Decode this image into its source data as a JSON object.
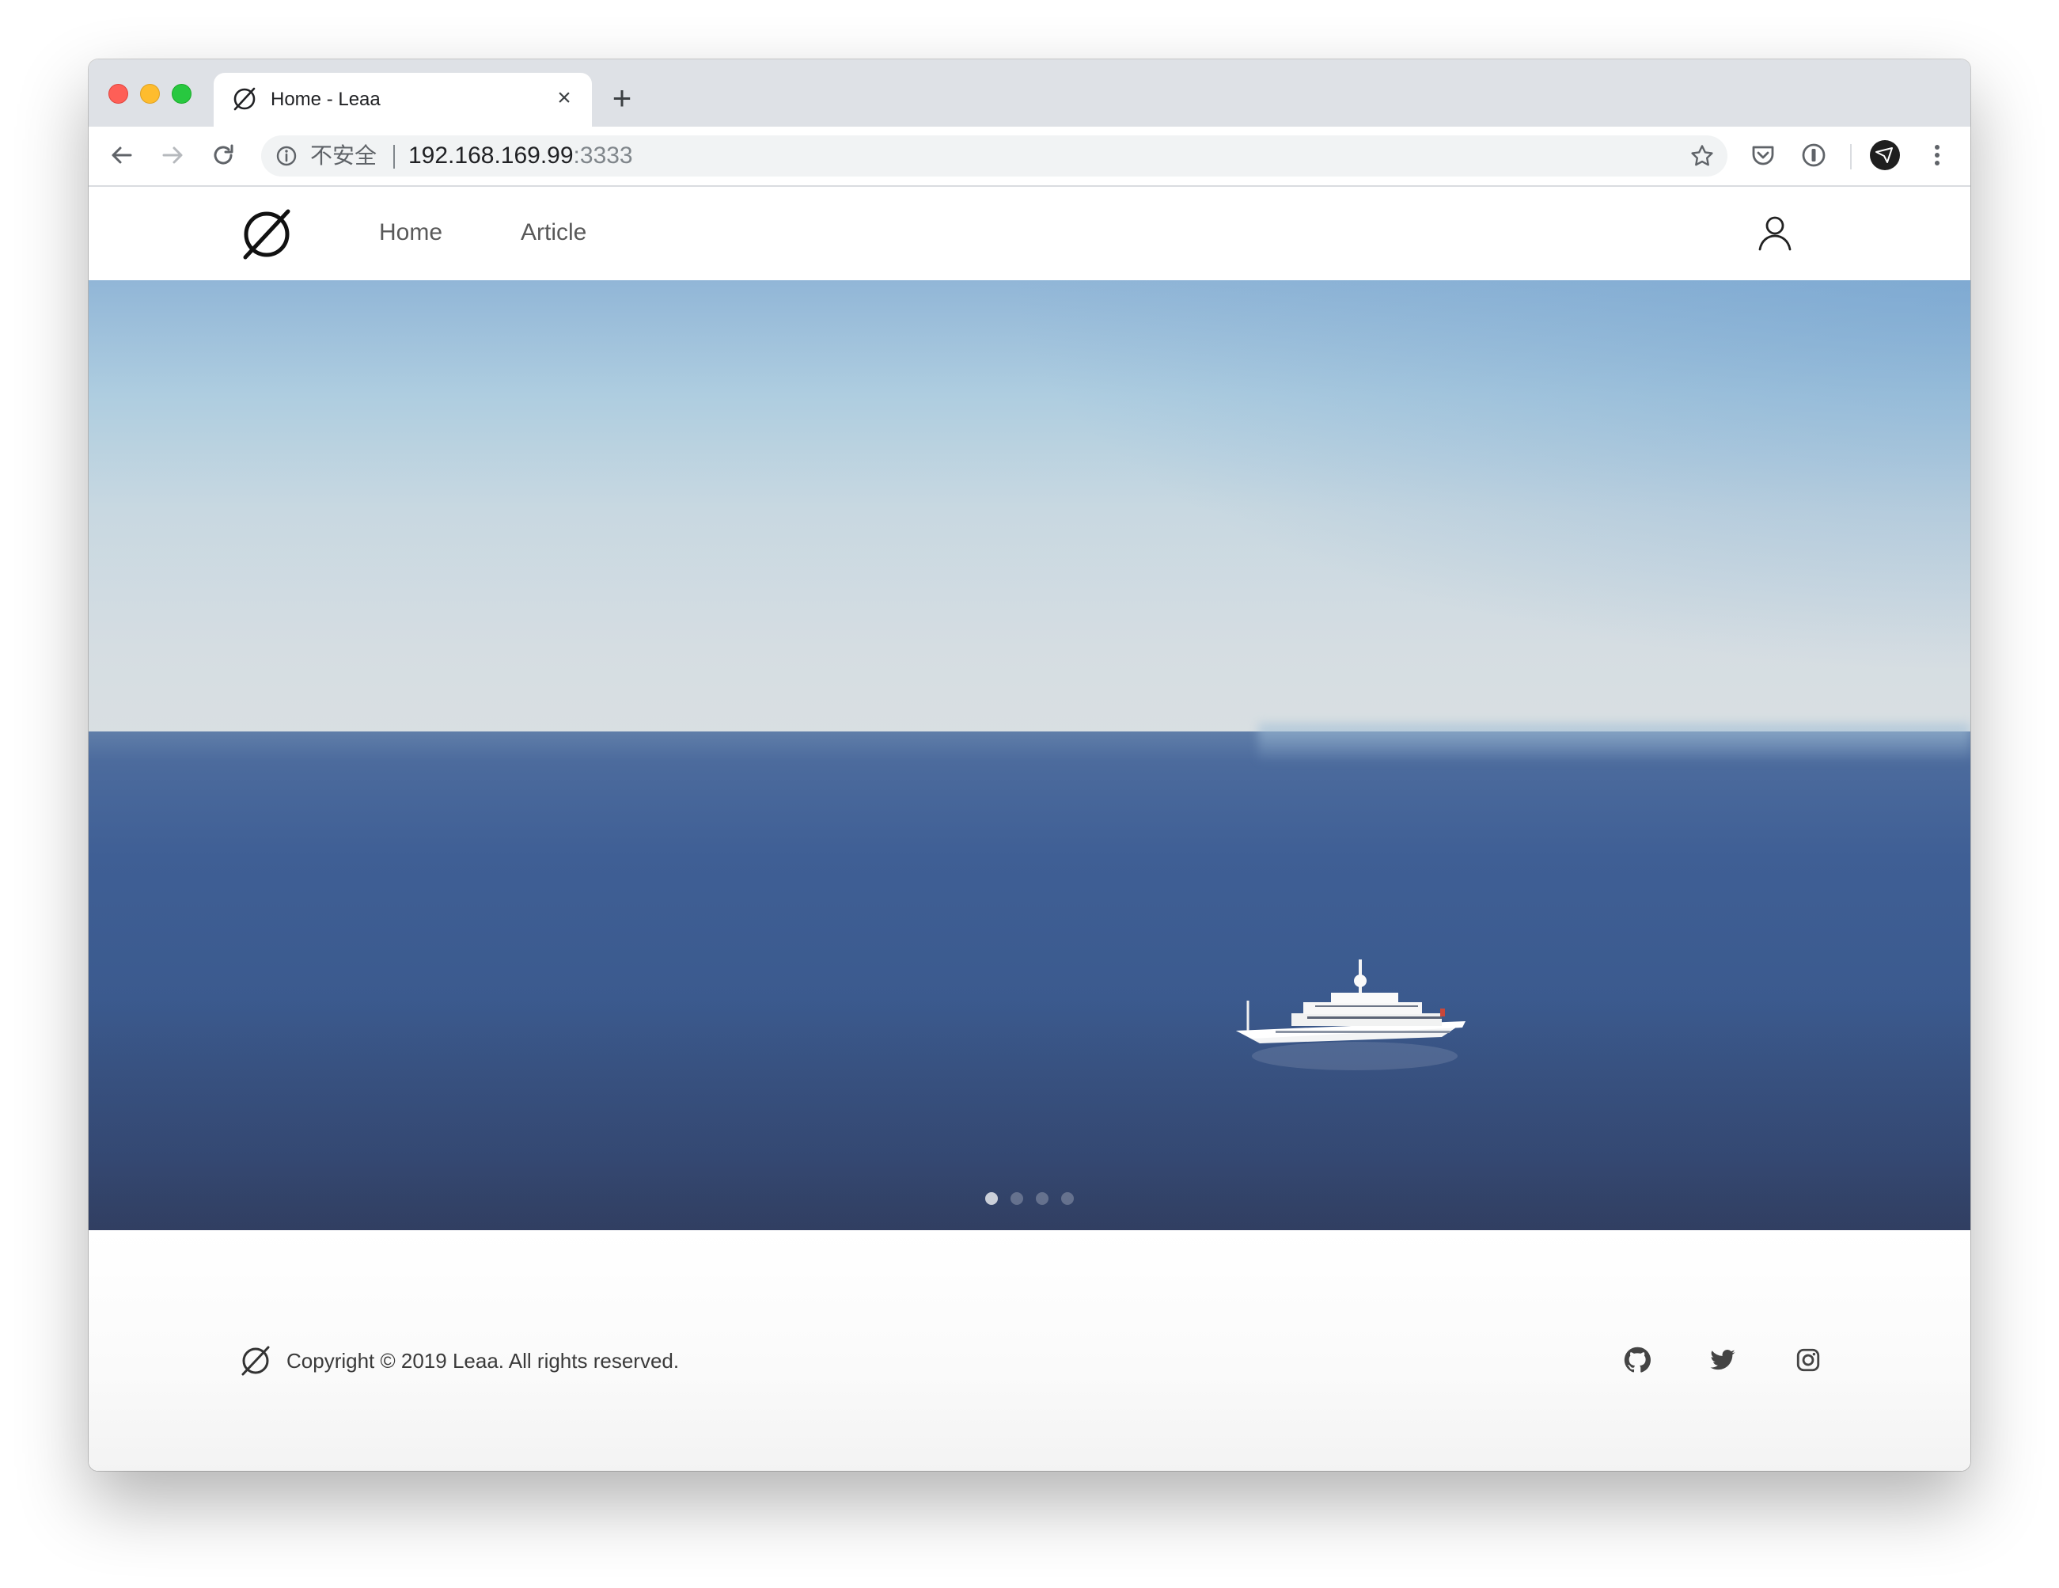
{
  "browser": {
    "tab": {
      "title": "Home - Leaa",
      "close_glyph": "×",
      "favicon": "leaa-logo-icon"
    },
    "new_tab_glyph": "+",
    "address_bar": {
      "security_label": "不安全",
      "url_host": "192.168.169.99",
      "url_port": ":3333"
    },
    "toolbar_icons": [
      "back-icon",
      "forward-icon",
      "reload-icon",
      "info-icon",
      "star-icon",
      "pocket-icon",
      "password-icon",
      "profile-avatar-icon",
      "menu-icon"
    ]
  },
  "site": {
    "nav": [
      {
        "label": "Home"
      },
      {
        "label": "Article"
      }
    ],
    "header_icons": [
      "leaa-logo-icon",
      "user-icon"
    ],
    "hero": {
      "slides": 4,
      "active_slide": 1,
      "image": "sea-with-white-yacht"
    },
    "footer": {
      "copyright": "Copyright © 2019 Leaa. All rights reserved.",
      "social_icons": [
        "github-icon",
        "twitter-icon",
        "instagram-icon"
      ]
    }
  },
  "colors": {
    "tabstrip_bg": "#dee1e6",
    "nav_text": "#595959",
    "sea": "#3f5f95",
    "sky": "#c8d8e1"
  }
}
